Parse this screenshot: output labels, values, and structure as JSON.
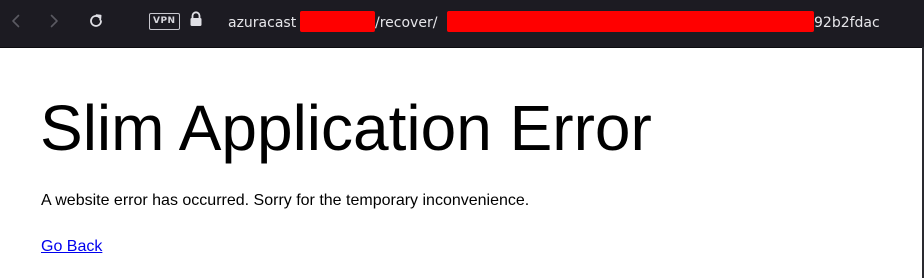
{
  "browser": {
    "vpn_label": "VPN",
    "url_host_prefix": "azuracast",
    "url_path": "/recover/",
    "url_tail": "92b2fdac",
    "redaction_color": "#ff0000"
  },
  "page": {
    "title": "Slim Application Error",
    "message": "A website error has occurred. Sorry for the temporary inconvenience.",
    "back_link": "Go Back",
    "link_color": "#0000ee"
  }
}
